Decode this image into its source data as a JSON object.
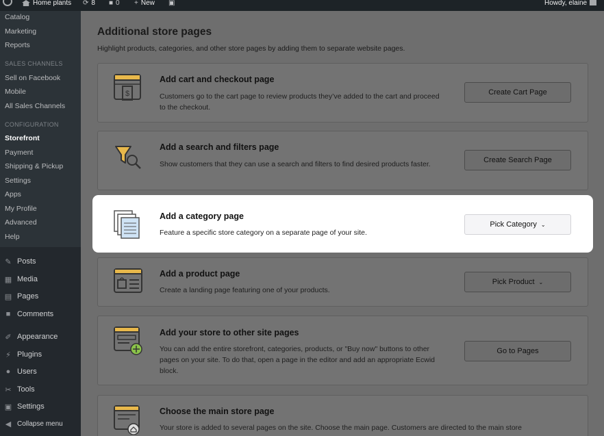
{
  "admin_bar": {
    "site_name": "Home plants",
    "updates_count": "8",
    "comments_count": "0",
    "new_label": "New",
    "howdy": "Howdy, elaine"
  },
  "sidebar": {
    "top_items": [
      "Catalog",
      "Marketing",
      "Reports"
    ],
    "sales_channels_heading": "SALES CHANNELS",
    "sales_channels": [
      "Sell on Facebook",
      "Mobile",
      "All Sales Channels"
    ],
    "configuration_heading": "CONFIGURATION",
    "configuration": [
      "Storefront",
      "Payment",
      "Shipping & Pickup",
      "Settings",
      "Apps",
      "My Profile",
      "Advanced",
      "Help"
    ],
    "main_menu": [
      {
        "label": "Posts",
        "icon": "pin-icon"
      },
      {
        "label": "Media",
        "icon": "media-icon"
      },
      {
        "label": "Pages",
        "icon": "pages-icon"
      },
      {
        "label": "Comments",
        "icon": "comment-icon"
      },
      {
        "label": "Appearance",
        "icon": "brush-icon"
      },
      {
        "label": "Plugins",
        "icon": "plugin-icon"
      },
      {
        "label": "Users",
        "icon": "user-icon"
      },
      {
        "label": "Tools",
        "icon": "wrench-icon"
      },
      {
        "label": "Settings",
        "icon": "settings-icon"
      },
      {
        "label": "Collapse menu",
        "icon": "collapse-icon"
      }
    ]
  },
  "main": {
    "title": "Additional store pages",
    "description": "Highlight products, categories, and other store pages by adding them to separate website pages.",
    "cards": [
      {
        "title": "Add cart and checkout page",
        "description": "Customers go to the cart page to review products they’ve added to the cart and proceed to the checkout.",
        "button": "Create Cart Page",
        "icon": "cart-page-icon"
      },
      {
        "title": "Add a search and filters page",
        "description": "Show customers that they can use a search and filters to find desired products faster.",
        "button": "Create Search Page",
        "icon": "search-filter-icon"
      },
      {
        "title": "Add a category page",
        "description": "Feature a specific store category on a separate page of your site.",
        "button": "Pick Category",
        "icon": "category-page-icon"
      },
      {
        "title": "Add a product page",
        "description": "Create a landing page featuring one of your products.",
        "button": "Pick Product",
        "icon": "product-page-icon"
      },
      {
        "title": "Add your store to other site pages",
        "description": "You can add the entire storefront, categories, products, or \"Buy now\" buttons to other pages on your site. To do that, open a page in the editor and add an appropriate Ecwid block.",
        "button": "Go to Pages",
        "icon": "add-page-icon"
      },
      {
        "title": "Choose the main store page",
        "description": "Your store is added to several pages on the site. Choose the main page. Customers are directed to the main store",
        "button": "",
        "icon": "home-page-icon"
      }
    ]
  },
  "colors": {
    "accent_yellow": "#e8b84b",
    "highlight": "#ffffff",
    "overlay": "#6e6e6e"
  }
}
